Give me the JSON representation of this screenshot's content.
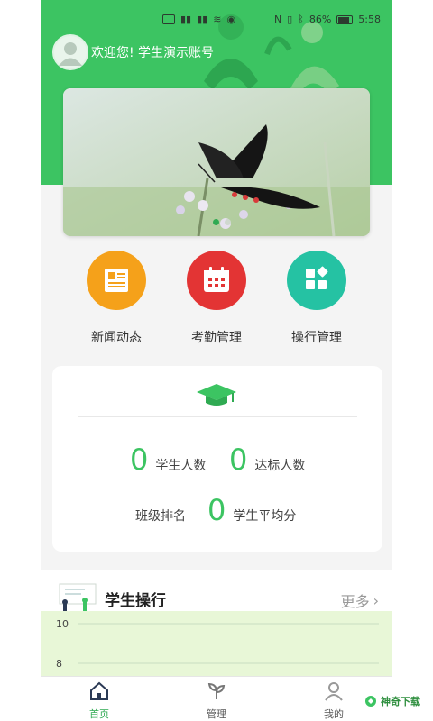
{
  "status_bar": {
    "battery": "86%",
    "time": "5:58"
  },
  "header": {
    "welcome": "欢迎您! 学生演示账号"
  },
  "banner": {
    "image": "butterfly-photo",
    "slide_count": 2,
    "active_slide": 1
  },
  "menu": [
    {
      "label": "新闻动态",
      "icon": "newspaper-icon",
      "color": "#f5a11a"
    },
    {
      "label": "考勤管理",
      "icon": "calendar-icon",
      "color": "#e33434"
    },
    {
      "label": "操行管理",
      "icon": "apps-grid-icon",
      "color": "#25c2a3"
    }
  ],
  "stats": {
    "icon": "graduation-cap-icon",
    "student_count": {
      "value": "0",
      "label": "学生人数"
    },
    "qualified_count": {
      "value": "0",
      "label": "达标人数"
    },
    "class_rank_label": "班级排名",
    "avg_score": {
      "value": "0",
      "label": "学生平均分"
    }
  },
  "conduct_section": {
    "title": "学生操行",
    "more": "更多",
    "chart_ticks": [
      "10",
      "8"
    ]
  },
  "tabbar": [
    {
      "label": "首页",
      "icon": "home-icon",
      "active": true
    },
    {
      "label": "管理",
      "icon": "sprout-icon",
      "active": false
    },
    {
      "label": "我的",
      "icon": "user-icon",
      "active": false
    }
  ],
  "watermark": {
    "text": "神奇下载"
  },
  "colors": {
    "primary": "#3cc462",
    "accent_dark": "#2faa52",
    "chart_bg": "#e8f7d7"
  }
}
